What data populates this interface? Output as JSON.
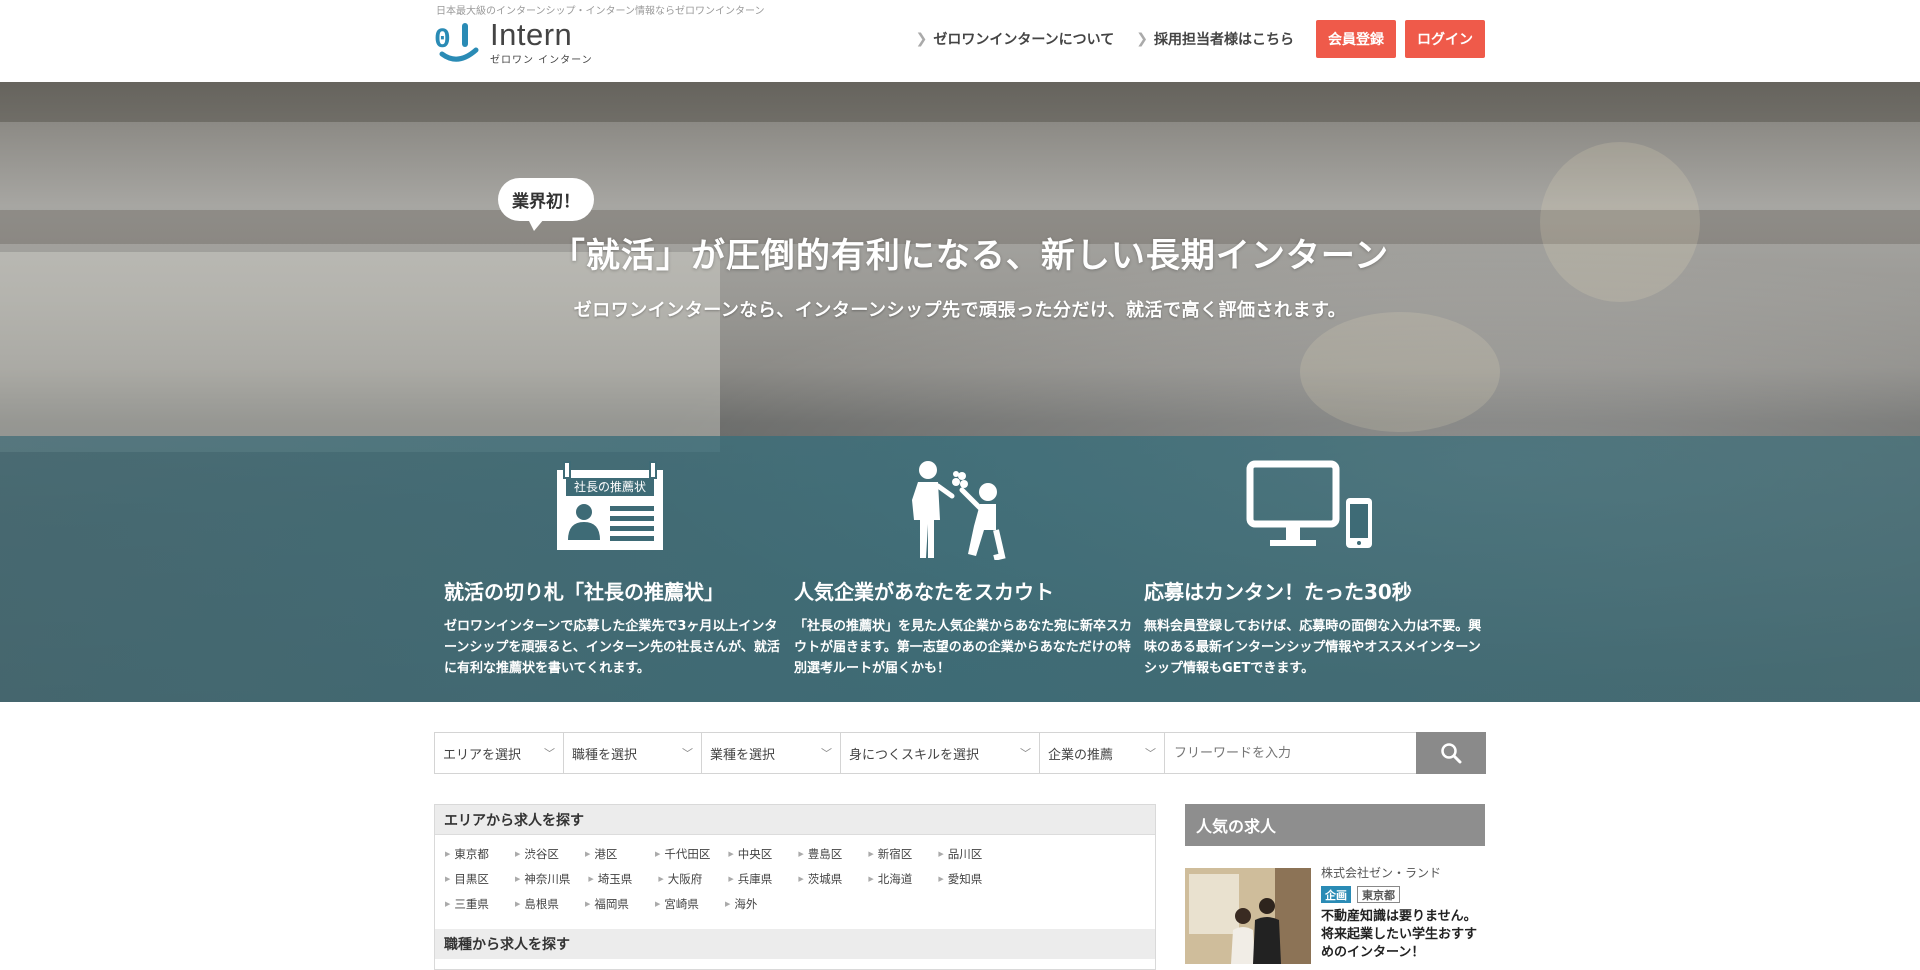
{
  "header": {
    "tagline": "日本最大級のインターンシップ・インターン情報ならゼロワンインターン",
    "logo_main": "Intern",
    "logo_sub": "ゼロワン インターン",
    "nav_about": "ゼロワンインターンについて",
    "nav_recruiter": "採用担当者様はこちら",
    "signup_label": "会員登録",
    "login_label": "ログイン"
  },
  "hero": {
    "badge": "業界初！",
    "title": "「就活」が圧倒的有利になる、新しい長期インターン",
    "subtitle": "ゼロワンインターンなら、インターンシップ先で頑張った分だけ、就活で高く評価されます。",
    "features": [
      {
        "icon": "recommendation-letter-icon",
        "icon_label": "社長の推薦状",
        "title": "就活の切り札「社長の推薦状」",
        "desc": "ゼロワンインターンで応募した企業先で3ヶ月以上インターンシップを頑張ると、インターン先の社長さんが、就活に有利な推薦状を書いてくれます。"
      },
      {
        "icon": "scout-icon",
        "title": "人気企業があなたをスカウト",
        "desc": "「社長の推薦状」を見た人気企業からあなた宛に新卒スカウトが届きます。第一志望のあの企業からあなただけの特別選考ルートが届くかも！"
      },
      {
        "icon": "devices-icon",
        "title": "応募はカンタン！たった30秒",
        "desc": "無料会員登録しておけば、応募時の面倒な入力は不要。興味のある最新インターンシップ情報やオススメインターンシップ情報もGETできます。"
      }
    ]
  },
  "search": {
    "area": "エリアを選択",
    "job_type": "職種を選択",
    "industry": "業種を選択",
    "skill": "身につくスキルを選択",
    "company_recommend": "企業の推薦",
    "freeword_placeholder": "フリーワードを入力"
  },
  "area_section": {
    "heading": "エリアから求人を探す",
    "items": [
      "東京都",
      "渋谷区",
      "港区",
      "千代田区",
      "中央区",
      "豊島区",
      "新宿区",
      "品川区",
      "目黒区",
      "神奈川県",
      "埼玉県",
      "大阪府",
      "兵庫県",
      "茨城県",
      "北海道",
      "愛知県",
      "三重県",
      "島根県",
      "福岡県",
      "宮崎県",
      "海外"
    ],
    "job_heading": "職種から求人を探す"
  },
  "popular": {
    "heading": "人気の求人",
    "company": "株式会社ゼン・ランド",
    "tag_type": "企画",
    "tag_area": "東京都",
    "text": "不動産知識は要りません。将来起業したい学生おすすめのインターン！"
  }
}
